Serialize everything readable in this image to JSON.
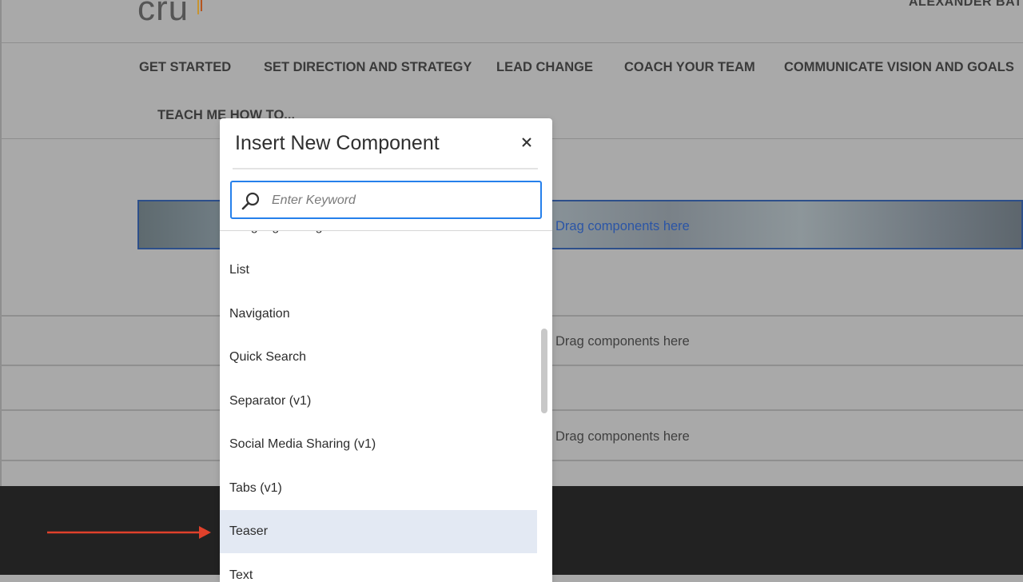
{
  "header": {
    "logo_text": "cru",
    "user_name": "ALEXANDER BATEMAN"
  },
  "nav": {
    "items": [
      {
        "label": "GET STARTED"
      },
      {
        "label": "SET DIRECTION AND STRATEGY"
      },
      {
        "label": "LEAD CHANGE"
      },
      {
        "label": "COACH YOUR TEAM"
      },
      {
        "label": "COMMUNICATE VISION AND GOALS"
      },
      {
        "label": "TEACH ME HOW TO..."
      }
    ]
  },
  "drop_zones": [
    {
      "label": "Drag components here"
    },
    {
      "label": "Drag components here"
    },
    {
      "label": "Drag components here"
    }
  ],
  "dialog": {
    "title": "Insert New Component",
    "close_icon": "close-icon",
    "search": {
      "placeholder": "Enter Keyword",
      "value": ""
    },
    "items": [
      {
        "label": "Language Navigation"
      },
      {
        "label": "List"
      },
      {
        "label": "Navigation"
      },
      {
        "label": "Quick Search"
      },
      {
        "label": "Separator (v1)"
      },
      {
        "label": "Social Media Sharing (v1)"
      },
      {
        "label": "Tabs (v1)"
      },
      {
        "label": "Teaser",
        "selected": true
      },
      {
        "label": "Text"
      }
    ]
  },
  "colors": {
    "accent": "#2680eb",
    "selected_bg": "#e3e9f3",
    "arrow": "#e0412b",
    "footer_bg": "#222222",
    "overlay_bg": "#a9a9a9"
  }
}
